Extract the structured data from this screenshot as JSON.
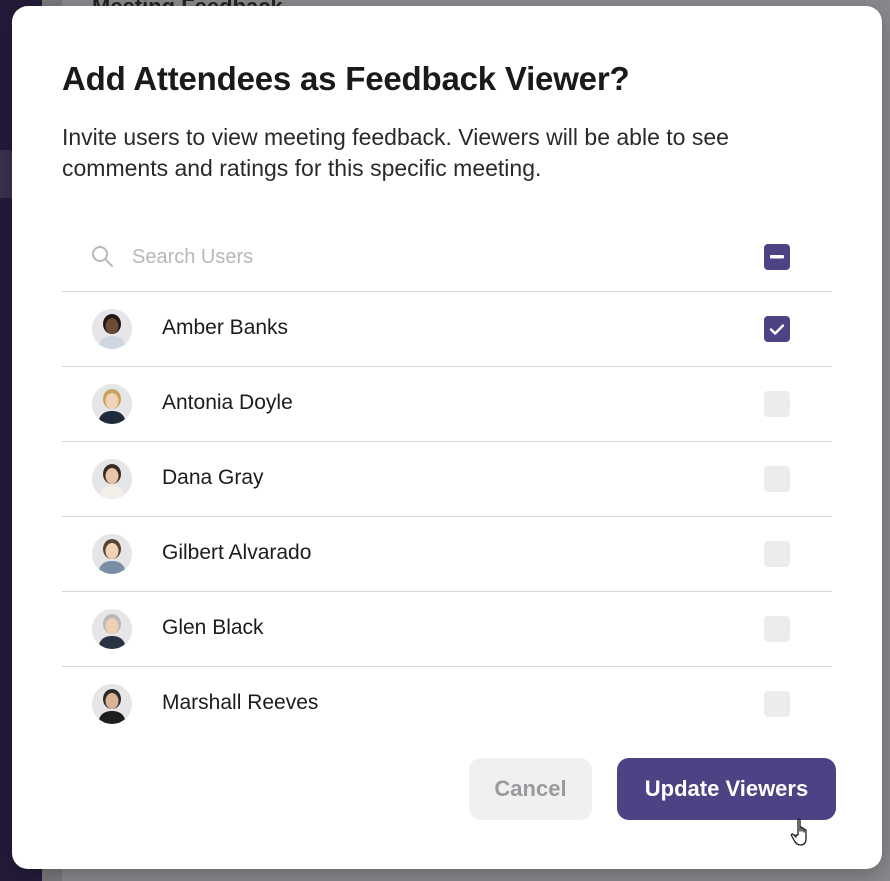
{
  "background": {
    "title": "Meeting Feedback"
  },
  "modal": {
    "title": "Add Attendees as Feedback Viewer?",
    "description": "Invite users to view meeting feedback. Viewers will be able to see comments and ratings for this specific meeting."
  },
  "search": {
    "placeholder": "Search Users",
    "value": "",
    "select_all_state": "partial"
  },
  "users": [
    {
      "name": "Amber Banks",
      "checked": true
    },
    {
      "name": "Antonia Doyle",
      "checked": false
    },
    {
      "name": "Dana Gray",
      "checked": false
    },
    {
      "name": "Gilbert Alvarado",
      "checked": false
    },
    {
      "name": "Glen Black",
      "checked": false
    },
    {
      "name": "Marshall Reeves",
      "checked": false
    }
  ],
  "buttons": {
    "cancel": "Cancel",
    "update": "Update Viewers"
  },
  "colors": {
    "accent": "#4d4283",
    "checkbox_off": "#ececee",
    "divider": "#d6d6d6"
  }
}
